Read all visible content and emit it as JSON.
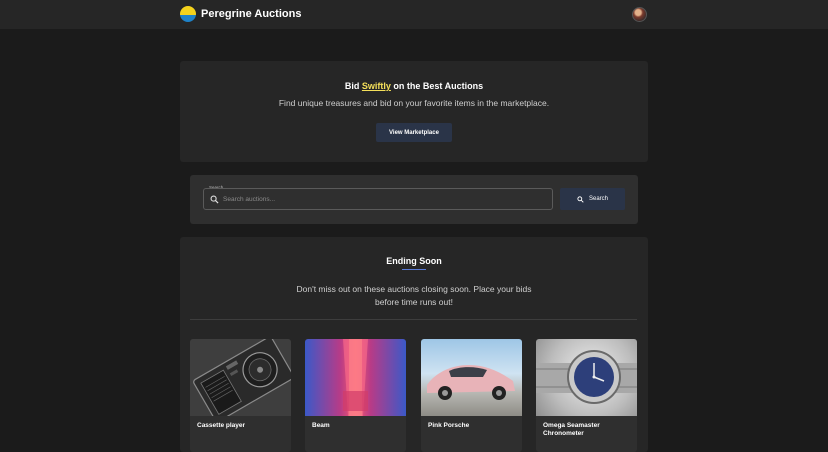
{
  "header": {
    "brand_name": "Peregrine Auctions",
    "logo_icon": "sun-over-water-logo-icon",
    "avatar_icon": "user-avatar-icon"
  },
  "hero": {
    "title_prefix": "Bid ",
    "title_highlight": "Swiftly",
    "title_suffix": " on the Best Auctions",
    "subtitle": "Find unique treasures and bid on your favorite items in the marketplace.",
    "button_label": "View Marketplace"
  },
  "search": {
    "label": "Search",
    "placeholder": "Search auctions...",
    "value": "",
    "button_label": "Search",
    "icon": "search-icon"
  },
  "ending_soon": {
    "title": "Ending Soon",
    "subtitle": "Don't miss out on these auctions closing soon. Place your bids before time runs out!",
    "items": [
      {
        "name": "Cassette player"
      },
      {
        "name": "Beam"
      },
      {
        "name": "Pink Porsche"
      },
      {
        "name": "Omega Seamaster Chronometer"
      }
    ]
  },
  "colors": {
    "background": "#1b1b1b",
    "card": "#262626",
    "button": "#2a3448",
    "highlight": "#f5e05a",
    "underline_accent": "#5a7bd6"
  }
}
